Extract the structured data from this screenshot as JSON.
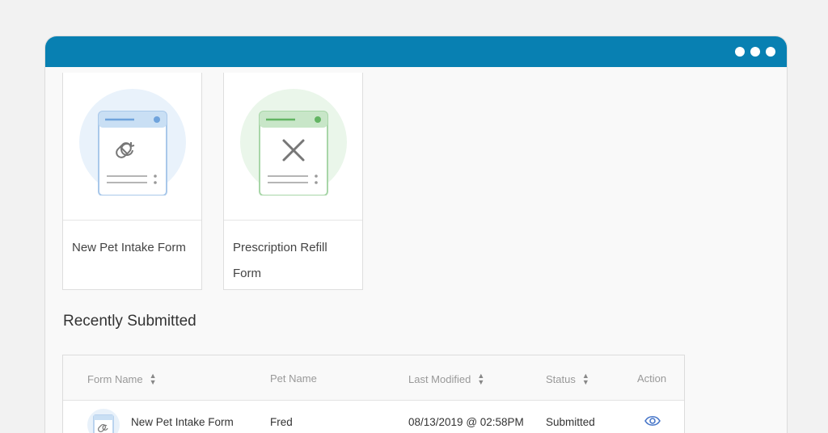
{
  "window": {
    "accent": "#0880b2"
  },
  "cards": [
    {
      "label": "New Pet Intake Form",
      "icon": "pill-refresh-icon",
      "color": "#4a90d9"
    },
    {
      "label": "Prescription Refill Form",
      "icon": "tools-cross-icon",
      "color": "#5cb85c"
    }
  ],
  "section": {
    "title": "Recently Submitted"
  },
  "table": {
    "headers": {
      "form_name": "Form Name",
      "pet_name": "Pet Name",
      "last_modified": "Last Modified",
      "status": "Status",
      "action": "Action"
    },
    "rows": [
      {
        "form_name": "New Pet Intake Form",
        "pet_name": "Fred",
        "last_modified": "08/13/2019 @ 02:58PM",
        "status": "Submitted",
        "action_icon": "eye-icon"
      }
    ]
  }
}
